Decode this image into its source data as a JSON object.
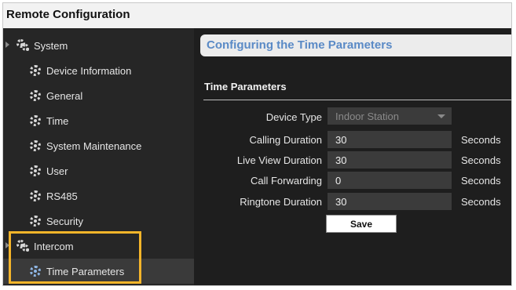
{
  "window": {
    "title": "Remote Configuration"
  },
  "sidebar": {
    "root": {
      "label": "System"
    },
    "items": [
      {
        "label": "Device Information"
      },
      {
        "label": "General"
      },
      {
        "label": "Time"
      },
      {
        "label": "System Maintenance"
      },
      {
        "label": "User"
      },
      {
        "label": "RS485"
      },
      {
        "label": "Security"
      }
    ],
    "intercom": {
      "label": "Intercom"
    },
    "intercom_items": [
      {
        "label": "Time Parameters"
      }
    ]
  },
  "main": {
    "header": "Configuring the Time Parameters",
    "section_title": "Time Parameters",
    "device_type": {
      "label": "Device Type",
      "value": "Indoor Station"
    },
    "fields": [
      {
        "label": "Calling Duration",
        "value": "30",
        "unit": "Seconds"
      },
      {
        "label": "Live View Duration",
        "value": "30",
        "unit": "Seconds"
      },
      {
        "label": "Call Forwarding",
        "value": "0",
        "unit": "Seconds"
      },
      {
        "label": "Ringtone Duration",
        "value": "30",
        "unit": "Seconds"
      }
    ],
    "save_label": "Save"
  },
  "colors": {
    "highlight": "#f5b52a",
    "header_text": "#5a8ac6",
    "background": "#1e1e1e"
  }
}
